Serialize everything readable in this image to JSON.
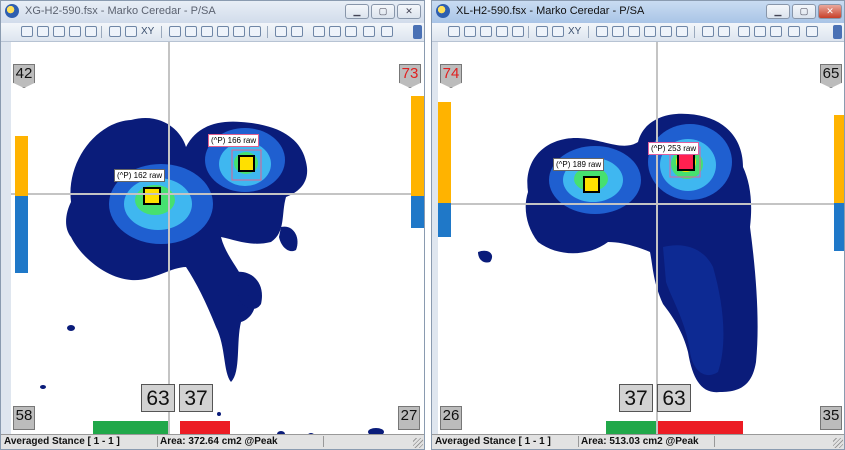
{
  "windows": [
    {
      "id": "left",
      "title": "XG-H2-590.fsx - Marko  Ceredar - P/SA",
      "corners": {
        "top_left": "42",
        "top_right": "73",
        "bottom_left": "58",
        "bottom_right": "27"
      },
      "corner_colors": {
        "top_left": "#111111",
        "top_right": "#e02020",
        "bottom_left": "#111111",
        "bottom_right": "#111111"
      },
      "split": {
        "left_pct": "63",
        "right_pct": "37"
      },
      "peaks": [
        {
          "label": "(^P) 162 raw"
        },
        {
          "label": "(^P) 166 raw"
        }
      ],
      "status": {
        "mode": "Averaged Stance [ 1 - 1 ]",
        "area": "Area: 372.64 cm2 @Peak"
      }
    },
    {
      "id": "right",
      "title": "XL-H2-590.fsx - Marko  Ceredar - P/SA",
      "corners": {
        "top_left": "74",
        "top_right": "65",
        "bottom_left": "26",
        "bottom_right": "35"
      },
      "corner_colors": {
        "top_left": "#e02020",
        "top_right": "#111111",
        "bottom_left": "#111111",
        "bottom_right": "#111111"
      },
      "split": {
        "left_pct": "37",
        "right_pct": "63"
      },
      "peaks": [
        {
          "label": "(^P) 189 raw"
        },
        {
          "label": "(^P) 253 raw"
        }
      ],
      "status": {
        "mode": "Averaged Stance [ 1 - 1 ]",
        "area": "Area: 513.03 cm2 @Peak"
      }
    }
  ],
  "toolbar": {
    "xy_label": "XY"
  },
  "colors": {
    "bar_orange": "#ffb300",
    "bar_blue": "#1f78c8",
    "split_green": "#21a84a",
    "split_red": "#ec1c24",
    "heat_dark": "#0a1c7a",
    "heat_mid": "#1f5fd0",
    "heat_light": "#3fb7f0",
    "heat_green": "#46e070",
    "heat_yellow": "#ffe000",
    "heat_peak": "#ff2020"
  },
  "icons": [
    "app-logo-icon",
    "minimize-icon",
    "maximize-icon",
    "close-icon",
    "open-icon",
    "save-icon",
    "print-icon",
    "zoom-icon",
    "xy-icon",
    "toolbar-scroll-icon"
  ]
}
